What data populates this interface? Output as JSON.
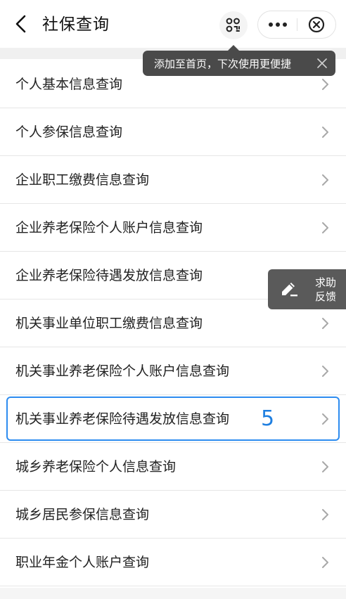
{
  "header": {
    "title": "社保查询"
  },
  "tooltip": {
    "text": "添加至首页，下次使用更便捷"
  },
  "menu": {
    "items": [
      {
        "label": "个人基本信息查询"
      },
      {
        "label": "个人参保信息查询"
      },
      {
        "label": "企业职工缴费信息查询"
      },
      {
        "label": "企业养老保险个人账户信息查询"
      },
      {
        "label": "企业养老保险待遇发放信息查询"
      },
      {
        "label": "机关事业单位职工缴费信息查询"
      },
      {
        "label": "机关事业养老保险个人账户信息查询"
      },
      {
        "label": "机关事业养老保险待遇发放信息查询"
      },
      {
        "label": "城乡养老保险个人信息查询"
      },
      {
        "label": "城乡居民参保信息查询"
      },
      {
        "label": "职业年金个人账户查询"
      }
    ],
    "highlight_marker": "5"
  },
  "help_float": {
    "line1": "求助",
    "line2": "反馈"
  },
  "colors": {
    "highlight_border": "#2d8cf0",
    "marker": "#1f7fe0",
    "tooltip_bg": "#4a4a4a",
    "help_bg": "#5a5a5a"
  },
  "icons": {
    "back": "chevron-left-icon",
    "scan": "scan-icon",
    "more": "more-dots-icon",
    "close": "close-circle-icon",
    "row": "chevron-right-icon",
    "help": "edit-pen-icon"
  }
}
